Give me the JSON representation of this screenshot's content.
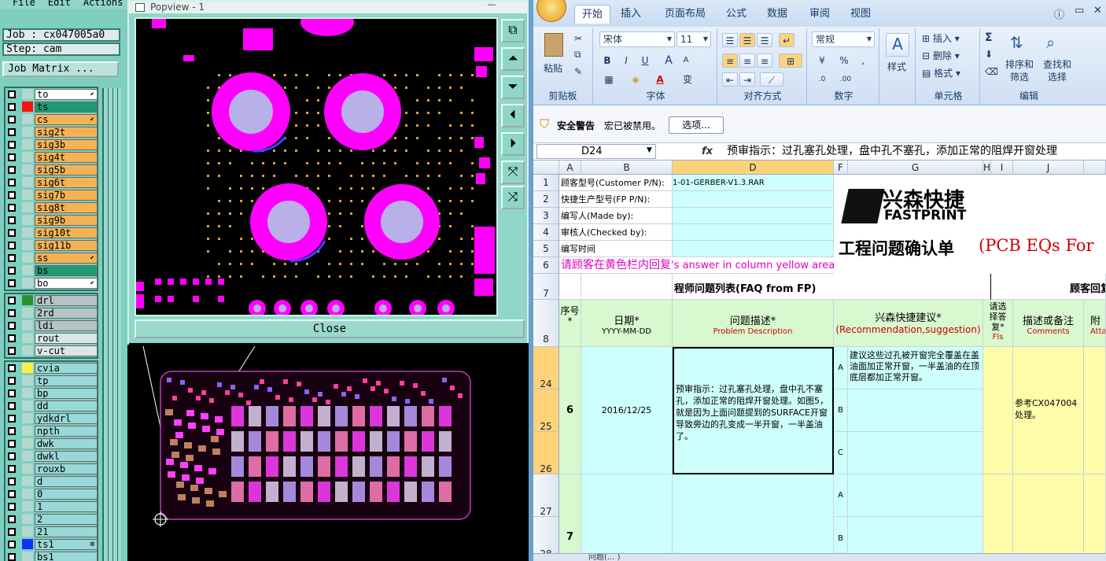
{
  "cam": {
    "menu": [
      "File",
      "Edit",
      "Actions"
    ],
    "job_label": "Job : cx047005a0",
    "step_label": "Step: cam",
    "job_matrix_label": "Job Matrix ...",
    "layer_groups": [
      {
        "layers": [
          {
            "name": "to",
            "color": "#ffffff",
            "swatch": "#b2d8d0",
            "mark": "⬋"
          },
          {
            "name": "ts",
            "color": "#1f9a74",
            "swatch": "#ff1010",
            "mark": ""
          },
          {
            "name": "cs",
            "color": "#f3b355",
            "swatch": "#b2d8d0",
            "mark": "⬋"
          },
          {
            "name": "sig2t",
            "color": "#f3b355",
            "swatch": "#b2d8d0",
            "mark": ""
          },
          {
            "name": "sig3b",
            "color": "#f3b355",
            "swatch": "#b2d8d0",
            "mark": ""
          },
          {
            "name": "sig4t",
            "color": "#f3b355",
            "swatch": "#b2d8d0",
            "mark": ""
          },
          {
            "name": "sig5b",
            "color": "#f3b355",
            "swatch": "#b2d8d0",
            "mark": ""
          },
          {
            "name": "sig6t",
            "color": "#f3b355",
            "swatch": "#b2d8d0",
            "mark": ""
          },
          {
            "name": "sig7b",
            "color": "#f3b355",
            "swatch": "#b2d8d0",
            "mark": ""
          },
          {
            "name": "sig8t",
            "color": "#f3b355",
            "swatch": "#b2d8d0",
            "mark": ""
          },
          {
            "name": "sig9b",
            "color": "#f3b355",
            "swatch": "#b2d8d0",
            "mark": ""
          },
          {
            "name": "sig10t",
            "color": "#f3b355",
            "swatch": "#b2d8d0",
            "mark": ""
          },
          {
            "name": "sig11b",
            "color": "#f3b355",
            "swatch": "#b2d8d0",
            "mark": ""
          },
          {
            "name": "ss",
            "color": "#f3b355",
            "swatch": "#b2d8d0",
            "mark": "⬋"
          },
          {
            "name": "bs",
            "color": "#1f9a74",
            "swatch": "#b2d8d0",
            "mark": ""
          },
          {
            "name": "bo",
            "color": "#ffffff",
            "swatch": "#b2d8d0",
            "mark": "⬋"
          }
        ]
      },
      {
        "layers": [
          {
            "name": "drl",
            "color": "#b4c4c4",
            "swatch": "#2f8f2f",
            "mark": ""
          },
          {
            "name": "2rd",
            "color": "#b4c4c4",
            "swatch": "#b2d8d0",
            "mark": ""
          },
          {
            "name": "ldi",
            "color": "#b4c4c4",
            "swatch": "#b2d8d0",
            "mark": ""
          },
          {
            "name": "rout",
            "color": "#dde6e6",
            "swatch": "#b2d8d0",
            "mark": ""
          },
          {
            "name": "v-cut",
            "color": "#dde6e6",
            "swatch": "#b2d8d0",
            "mark": ""
          }
        ]
      },
      {
        "layers": [
          {
            "name": "cvia",
            "color": "#99d8d8",
            "swatch": "#ffef40",
            "mark": ""
          },
          {
            "name": "tp",
            "color": "#99d8d8",
            "swatch": "#b2d8d0",
            "mark": ""
          },
          {
            "name": "bp",
            "color": "#99d8d8",
            "swatch": "#b2d8d0",
            "mark": ""
          },
          {
            "name": "dd",
            "color": "#99d8d8",
            "swatch": "#b2d8d0",
            "mark": ""
          },
          {
            "name": "ydkdrl",
            "color": "#99d8d8",
            "swatch": "#b2d8d0",
            "mark": ""
          },
          {
            "name": "npth",
            "color": "#99d8d8",
            "swatch": "#b2d8d0",
            "mark": ""
          },
          {
            "name": "dwk",
            "color": "#99d8d8",
            "swatch": "#b2d8d0",
            "mark": ""
          },
          {
            "name": "dwkl",
            "color": "#99d8d8",
            "swatch": "#b2d8d0",
            "mark": ""
          },
          {
            "name": "rouxb",
            "color": "#99d8d8",
            "swatch": "#b2d8d0",
            "mark": ""
          },
          {
            "name": "d",
            "color": "#99d8d8",
            "swatch": "#b2d8d0",
            "mark": ""
          },
          {
            "name": "0",
            "color": "#99d8d8",
            "swatch": "#b2d8d0",
            "mark": ""
          },
          {
            "name": "1",
            "color": "#99d8d8",
            "swatch": "#b2d8d0",
            "mark": ""
          },
          {
            "name": "2",
            "color": "#99d8d8",
            "swatch": "#b2d8d0",
            "mark": ""
          },
          {
            "name": "21",
            "color": "#99d8d8",
            "swatch": "#b2d8d0",
            "mark": ""
          },
          {
            "name": "ts1",
            "color": "#99d8d8",
            "swatch": "#1030ff",
            "mark": "⊞"
          },
          {
            "name": "bs1",
            "color": "#99d8d8",
            "swatch": "#b2d8d0",
            "mark": ""
          }
        ]
      }
    ],
    "popview": {
      "title": "Popview - 1",
      "close_label": "Close",
      "title_close_glyph": "—"
    }
  },
  "excel": {
    "tabs": [
      "开始",
      "插入",
      "页面布局",
      "公式",
      "数据",
      "审阅",
      "视图"
    ],
    "clipboard": {
      "group": "剪贴板",
      "paste": "粘贴"
    },
    "font": {
      "group": "字体",
      "name": "宋体",
      "size": "11",
      "bold": "B",
      "italic": "I",
      "underline": "U",
      "grow": "A",
      "shrink": "A",
      "wen": "变"
    },
    "align": {
      "group": "对齐方式"
    },
    "number": {
      "group": "数字",
      "format": "常规",
      "percent": "%",
      "comma": ","
    },
    "styles": {
      "label": "样式"
    },
    "cells": {
      "group": "单元格",
      "insert": "插入",
      "delete": "删除",
      "format": "格式"
    },
    "edit": {
      "group": "编辑",
      "sigma": "Σ",
      "sort": "排序和\n筛选",
      "find": "查找和\n选择"
    },
    "security": {
      "title": "安全警告",
      "message": "宏已被禁用。",
      "options_button": "选项..."
    },
    "name_box": "D24",
    "fx": "fx",
    "formula": "预审指示：过孔塞孔处理，盘中孔不塞孔，添加正常的阻焊开窗处理",
    "columns": [
      "A",
      "B",
      "D",
      "F",
      "G",
      "H",
      "I",
      "J"
    ],
    "rows": [
      "1",
      "2",
      "3",
      "4",
      "5",
      "6",
      "7",
      "8",
      "24",
      "25",
      "26",
      "27",
      "28"
    ],
    "sheet": {
      "r1": "顾客型号(Customer P/N):",
      "r1_value": "1-01-GERBER-V1.3.RAR",
      "r2": "快捷生产型号(FP P/N):",
      "r3": "编写人(Made by):",
      "r4": "审核人(Checked by):",
      "r5": "编写时间",
      "r6": "请顾客在黄色栏内回复",
      "r6_en": "'s answer in column yellow area)",
      "title_cn": "工程问题确认单",
      "title_en": "(PCB EQs For",
      "logo_cn": "兴森快捷",
      "logo_en": "FASTPRINT",
      "r7_left": "程师问题列表(FAQ from FP)",
      "r7_right": "顾客回复",
      "hdr_seq": "序号*",
      "hdr_date": "日期*",
      "hdr_date_fmt": "YYYY-MM-DD",
      "hdr_problem": "问题描述*",
      "hdr_problem_en": "Problem Description",
      "hdr_reco": "兴森快捷建议*",
      "hdr_reco_en": "(Recommendation,suggestion)",
      "hdr_choose": "请选择答复*",
      "hdr_choose_en": "Fls",
      "hdr_comment": "描述或备注",
      "hdr_comment_en": "Comments",
      "hdr_attach": "附",
      "hdr_attach_en": "Attac",
      "seq6": "6",
      "date6": "2016/12/25",
      "problem6": "预审指示：过孔塞孔处理，盘中孔不塞孔，添加正常的阻焊开窗处理。如图5，就是因为上面问题提到的SURFACE开窗导致旁边的孔变成一半开窗，一半盖油了。",
      "optA": "A",
      "optB": "B",
      "optC": "C",
      "recoA": "建议这些过孔被开窗完全覆盖在盖油面加正常开窗，一半盖油的在顶底层都加正常开窗。",
      "comment6": "参考CX047004处理。",
      "seq7": "7"
    },
    "sheet_tabs": "问题(...  )"
  }
}
